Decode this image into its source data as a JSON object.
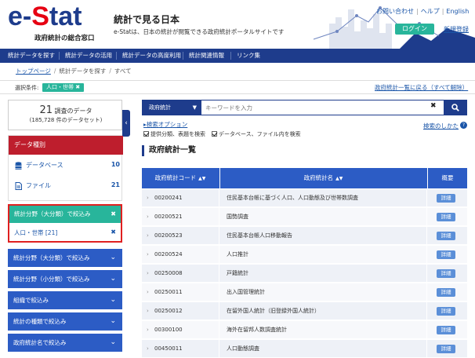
{
  "header": {
    "logo_e": "e-",
    "logo_s": "S",
    "logo_tat": "tat",
    "logo_sub": "政府統計の総合窓口",
    "title": "統計で見る日本",
    "description": "e-Statは、日本の統計が閲覧できる政府統計ポータルサイトです",
    "links": [
      "お問い合わせ",
      "ヘルプ",
      "English"
    ],
    "login": "ログイン",
    "register": "新規登録"
  },
  "nav": {
    "items": [
      "統計データを探す",
      "統計データの活用",
      "統計データの高度利用",
      "統計関連情報",
      "リンク集"
    ]
  },
  "breadcrumb": {
    "top": "トップページ",
    "search": "統計データを探す",
    "current": "すべて"
  },
  "conditions": {
    "label": "選択条件:",
    "tag": "人口・世帯 ✖",
    "back_link": "政府統計一覧に戻る（すべて解除）"
  },
  "count": {
    "number": "21",
    "unit": "調査のデータ",
    "datasets": "(185,728 件のデータセット)"
  },
  "data_type": {
    "header": "データ種別",
    "items": [
      {
        "label": "データベース",
        "count": "10"
      },
      {
        "label": "ファイル",
        "count": "21"
      }
    ]
  },
  "filter": {
    "header": "統計分野（大分類）で絞込み",
    "item": "人口・世帯 [21]"
  },
  "facets": [
    "統計分野（大分類）で絞込み",
    "統計分野（小分類）で絞込み",
    "組織で絞込み",
    "統計の種類で絞込み",
    "政府統計名で絞込み"
  ],
  "search": {
    "select": "政府統計",
    "placeholder": "キーワードを入力",
    "advanced": "▸検索オプション",
    "how": "検索のしかた",
    "check1": "提供分類、表題を検索",
    "check2": "データベース、ファイル内を検索"
  },
  "list_title": "政府統計一覧",
  "table": {
    "headers": {
      "code": "政府統計コード",
      "name": "政府統計名",
      "detail": "概要"
    },
    "detail_label": "詳細",
    "rows": [
      {
        "code": "00200241",
        "name": "住民基本台帳に基づく人口、人口動態及び世帯数調査"
      },
      {
        "code": "00200521",
        "name": "国勢調査"
      },
      {
        "code": "00200523",
        "name": "住民基本台帳人口移動報告"
      },
      {
        "code": "00200524",
        "name": "人口推計"
      },
      {
        "code": "00250008",
        "name": "戸籍統計"
      },
      {
        "code": "00250011",
        "name": "出入国管理統計"
      },
      {
        "code": "00250012",
        "name": "在留外国人統計（旧登録外国人統計）"
      },
      {
        "code": "00300100",
        "name": "海外在留邦人数調査統計"
      },
      {
        "code": "00450011",
        "name": "人口動態調査"
      }
    ]
  },
  "colors": {
    "navy": "#1e3c8c",
    "teal": "#28b59b",
    "red": "#be1e2d",
    "blue": "#2c5cc5"
  }
}
